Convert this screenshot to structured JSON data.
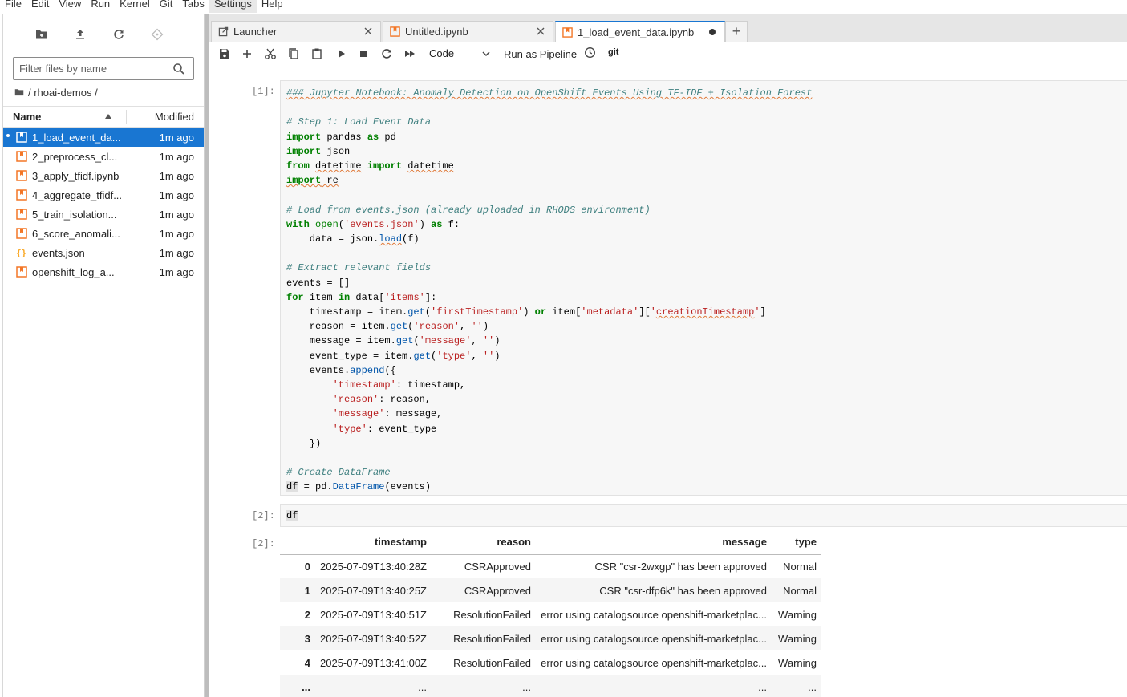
{
  "menu": [
    "File",
    "Edit",
    "View",
    "Run",
    "Kernel",
    "Git",
    "Tabs",
    "Settings",
    "Help"
  ],
  "filebrowser": {
    "filter_placeholder": "Filter files by name",
    "breadcrumb": "/ rhoai-demos /",
    "col_name": "Name",
    "col_modified": "Modified",
    "files": [
      {
        "name": "1_load_event_da...",
        "modified": "1m ago",
        "type": "notebook",
        "selected": true
      },
      {
        "name": "2_preprocess_cl...",
        "modified": "1m ago",
        "type": "notebook"
      },
      {
        "name": "3_apply_tfidf.ipynb",
        "modified": "1m ago",
        "type": "notebook"
      },
      {
        "name": "4_aggregate_tfidf...",
        "modified": "1m ago",
        "type": "notebook"
      },
      {
        "name": "5_train_isolation...",
        "modified": "1m ago",
        "type": "notebook"
      },
      {
        "name": "6_score_anomali...",
        "modified": "1m ago",
        "type": "notebook"
      },
      {
        "name": "events.json",
        "modified": "1m ago",
        "type": "json"
      },
      {
        "name": "openshift_log_a...",
        "modified": "1m ago",
        "type": "notebook"
      }
    ]
  },
  "tabs": [
    {
      "label": "Launcher",
      "icon": "launcher-icon"
    },
    {
      "label": "Untitled.ipynb",
      "icon": "notebook-icon"
    },
    {
      "label": "1_load_event_data.ipynb",
      "icon": "notebook-icon",
      "active": true
    }
  ],
  "toolbar": {
    "cell_type": "Code",
    "run_as_pipeline": "Run as Pipeline",
    "git": "git"
  },
  "cells": [
    {
      "prompt": "[1]:"
    },
    {
      "prompt": "[2]:",
      "source": "df"
    },
    {
      "prompt": "[2]:"
    }
  ],
  "output_table": {
    "columns": [
      "",
      "timestamp",
      "reason",
      "message",
      "type"
    ],
    "rows": [
      [
        "0",
        "2025-07-09T13:40:28Z",
        "CSRApproved",
        "CSR \"csr-2wxgp\" has been approved",
        "Normal"
      ],
      [
        "1",
        "2025-07-09T13:40:25Z",
        "CSRApproved",
        "CSR \"csr-dfp6k\" has been approved",
        "Normal"
      ],
      [
        "2",
        "2025-07-09T13:40:51Z",
        "ResolutionFailed",
        "error using catalogsource openshift-marketplac...",
        "Warning"
      ],
      [
        "3",
        "2025-07-09T13:40:52Z",
        "ResolutionFailed",
        "error using catalogsource openshift-marketplac...",
        "Warning"
      ],
      [
        "4",
        "2025-07-09T13:41:00Z",
        "ResolutionFailed",
        "error using catalogsource openshift-marketplac...",
        "Warning"
      ],
      [
        "...",
        "...",
        "...",
        "...",
        "..."
      ]
    ]
  }
}
